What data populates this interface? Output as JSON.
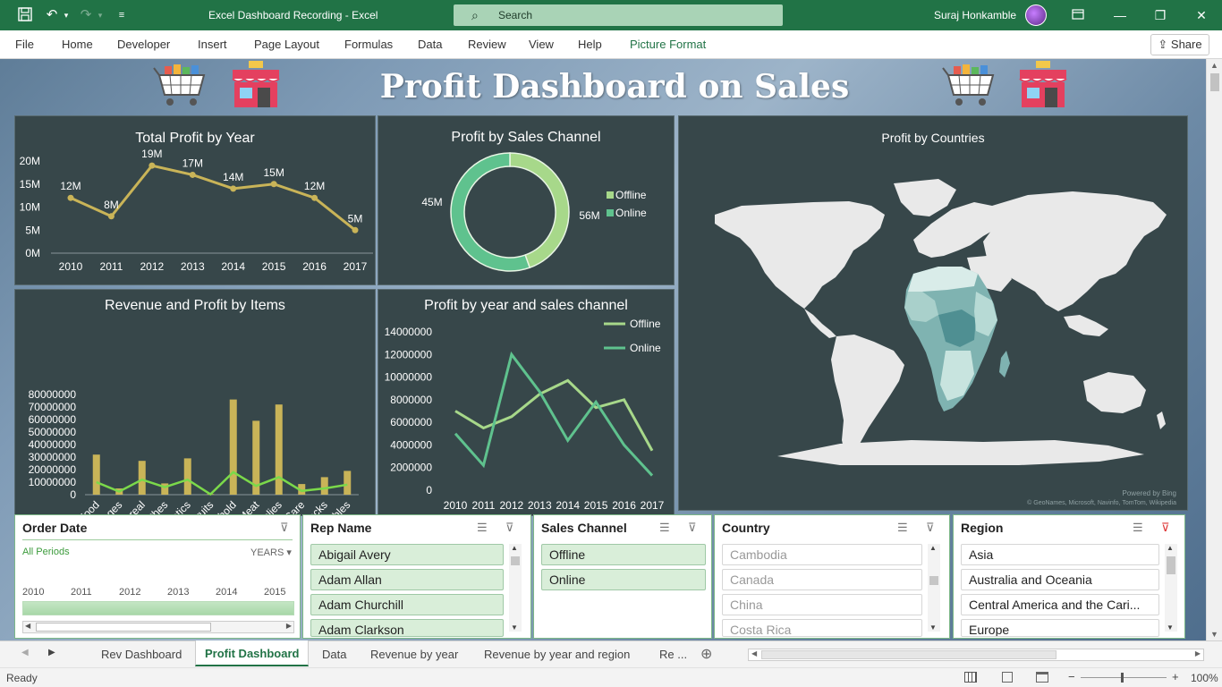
{
  "titlebar": {
    "doc_title": "Excel Dashboard Recording  -  Excel",
    "search_placeholder": "Search",
    "user": "Suraj Honkamble"
  },
  "ribbon": {
    "tabs": [
      "File",
      "Home",
      "Developer",
      "Insert",
      "Page Layout",
      "Formulas",
      "Data",
      "Review",
      "View",
      "Help",
      "Picture Format"
    ],
    "share": "Share"
  },
  "dashboard": {
    "title": "Profit Dashboard on Sales"
  },
  "charts": {
    "total_profit": {
      "title": "Total Profit by Year",
      "y_ticks": [
        "20M",
        "15M",
        "10M",
        "5M",
        "0M"
      ],
      "x_ticks": [
        "2010",
        "2011",
        "2012",
        "2013",
        "2014",
        "2015",
        "2016",
        "2017"
      ],
      "data_labels": [
        "12M",
        "8M",
        "19M",
        "17M",
        "14M",
        "15M",
        "12M",
        "5M"
      ]
    },
    "sales_channel": {
      "title": "Profit by Sales Channel",
      "labels": [
        "45M",
        "56M"
      ],
      "legend": [
        "Offline",
        "Online"
      ]
    },
    "countries": {
      "title": "Profit by Countries",
      "credit_1": "Powered by Bing",
      "credit_2": "© GeoNames, Microsoft, Navinfo, TomTom, Wikipedia"
    },
    "items": {
      "title": "Revenue and Profit by Items",
      "y_ticks": [
        "80000000",
        "70000000",
        "60000000",
        "50000000",
        "40000000",
        "30000000",
        "20000000",
        "10000000",
        "0"
      ],
      "categories": [
        "Baby Food",
        "Beverages",
        "Cereal",
        "Clothes",
        "Cosmetics",
        "Fruits",
        "Household",
        "Meat",
        "Office Supplies",
        "Personal Care",
        "Snacks",
        "Vegetables"
      ]
    },
    "year_channel": {
      "title": "Profit by year and sales channel",
      "y_ticks": [
        "14000000",
        "12000000",
        "10000000",
        "8000000",
        "6000000",
        "4000000",
        "2000000",
        "0"
      ],
      "x_ticks": [
        "2010",
        "2011",
        "2012",
        "2013",
        "2014",
        "2015",
        "2016",
        "2017"
      ],
      "legend": [
        "Offline",
        "Online"
      ]
    }
  },
  "chart_data": [
    {
      "type": "line",
      "title": "Total Profit by Year",
      "x": [
        2010,
        2011,
        2012,
        2013,
        2014,
        2015,
        2016,
        2017
      ],
      "values": [
        12,
        8,
        19,
        17,
        14,
        15,
        12,
        5
      ],
      "units": "M",
      "ylim": [
        0,
        20
      ]
    },
    {
      "type": "pie",
      "title": "Profit by Sales Channel",
      "categories": [
        "Offline",
        "Online"
      ],
      "values": [
        45,
        56
      ],
      "units": "M",
      "donut": true
    },
    {
      "type": "bar",
      "title": "Revenue and Profit by Items",
      "categories": [
        "Baby Food",
        "Beverages",
        "Cereal",
        "Clothes",
        "Cosmetics",
        "Fruits",
        "Household",
        "Meat",
        "Office Supplies",
        "Personal Care",
        "Snacks",
        "Vegetables"
      ],
      "series": [
        {
          "values": [
            32000000,
            5000000,
            27000000,
            9000000,
            29000000,
            500000,
            76000000,
            59000000,
            72000000,
            8500000,
            14000000,
            19000000
          ]
        },
        {
          "values": [
            10000000,
            2500000,
            12000000,
            6000000,
            12000000,
            300000,
            18000000,
            7000000,
            14000000,
            3000000,
            5000000,
            8000000
          ]
        }
      ],
      "ylim": [
        0,
        80000000
      ]
    },
    {
      "type": "line",
      "title": "Profit by year and sales channel",
      "x": [
        2010,
        2011,
        2012,
        2013,
        2014,
        2015,
        2016,
        2017
      ],
      "series": [
        {
          "name": "Offline",
          "values": [
            7000000,
            5500000,
            6500000,
            8500000,
            9700000,
            7300000,
            8000000,
            3500000
          ]
        },
        {
          "name": "Online",
          "values": [
            5000000,
            2200000,
            12000000,
            8700000,
            4400000,
            7800000,
            4000000,
            1300000
          ]
        }
      ],
      "ylim": [
        0,
        14000000
      ]
    }
  ],
  "slicers": {
    "order_date": {
      "title": "Order Date",
      "period": "All Periods",
      "level": "YEARS",
      "years": [
        "2010",
        "2011",
        "2012",
        "2013",
        "2014",
        "2015"
      ]
    },
    "rep_name": {
      "title": "Rep Name",
      "items": [
        "Abigail Avery",
        "Adam Allan",
        "Adam Churchill",
        "Adam Clarkson"
      ]
    },
    "sales_channel": {
      "title": "Sales Channel",
      "items": [
        "Offline",
        "Online"
      ]
    },
    "country": {
      "title": "Country",
      "items": [
        "Cambodia",
        "Canada",
        "China",
        "Costa Rica"
      ]
    },
    "region": {
      "title": "Region",
      "items": [
        "Asia",
        "Australia and Oceania",
        "Central America and the Cari...",
        "Europe"
      ]
    }
  },
  "sheet_tabs": [
    "Rev Dashboard",
    "Profit Dashboard",
    "Data",
    "Revenue by year",
    "Revenue by year and region",
    "Re ..."
  ],
  "status": {
    "ready": "Ready",
    "zoom": "100%"
  },
  "colors": {
    "excel_green": "#217346",
    "panel": "#37474a",
    "line_gold": "#c9b458",
    "offline": "#a7d88a",
    "online": "#5fc28e"
  }
}
